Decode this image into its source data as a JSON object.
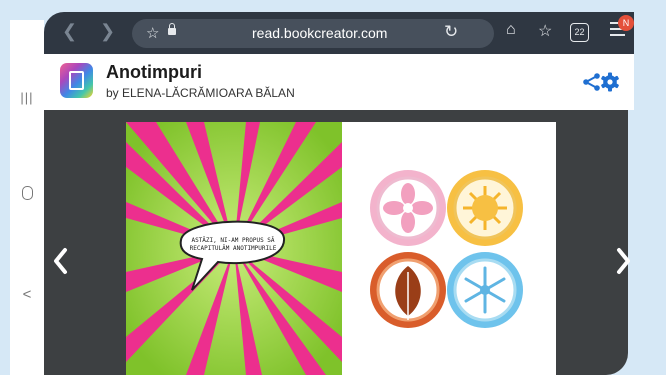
{
  "browser": {
    "url": "read.bookcreator.com",
    "tabs_count": "22",
    "profile_badge": "N"
  },
  "app": {
    "book_title": "Anotimpuri",
    "book_author": "by ELENA-LĂCRĂMIOARA BĂLAN",
    "accent_color": "#1f6fd1"
  },
  "page": {
    "speech_bubble_text": "ASTĂZI, NI-AM PROPUS SĂ RECAPITULĂM ANOTIMPURILE",
    "season_icons": [
      "flower-icon",
      "sun-icon",
      "leaf-icon",
      "snowflake-icon"
    ]
  },
  "colors": {
    "comic_green": "#8fcc3a",
    "comic_pink": "#ec2f8e",
    "viewer_bg": "#3d4042",
    "toolbar_bg": "#2f3742"
  }
}
